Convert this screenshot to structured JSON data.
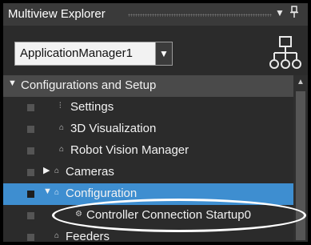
{
  "window": {
    "title": "Multiview Explorer",
    "title_chevron_icon": "chevron-down-icon",
    "pin_icon": "pin-icon"
  },
  "toolbar": {
    "app_select": {
      "value": "ApplicationManager1",
      "arrow": "▼"
    },
    "hierarchy_icon": "hierarchy-icon"
  },
  "tree": {
    "root": {
      "label": "Configurations and Setup",
      "expanded": true
    },
    "items": [
      {
        "label": "Settings",
        "icon": "settings-icon"
      },
      {
        "label": "3D Visualization",
        "icon": "lock-icon"
      },
      {
        "label": "Robot Vision Manager",
        "icon": "lock-icon"
      },
      {
        "label": "Cameras",
        "icon": "lock-icon",
        "expandable": true
      },
      {
        "label": "Configuration",
        "icon": "lock-icon",
        "expanded": true,
        "selected": true
      },
      {
        "label": "Controller Connection Startup0",
        "icon": "gear-icon"
      },
      {
        "label": "Feeders",
        "icon": "lock-icon"
      }
    ]
  },
  "colors": {
    "selection": "#3e8ed0",
    "panel_bg": "#2b2b2b",
    "header_bg": "#4a4a4a"
  }
}
